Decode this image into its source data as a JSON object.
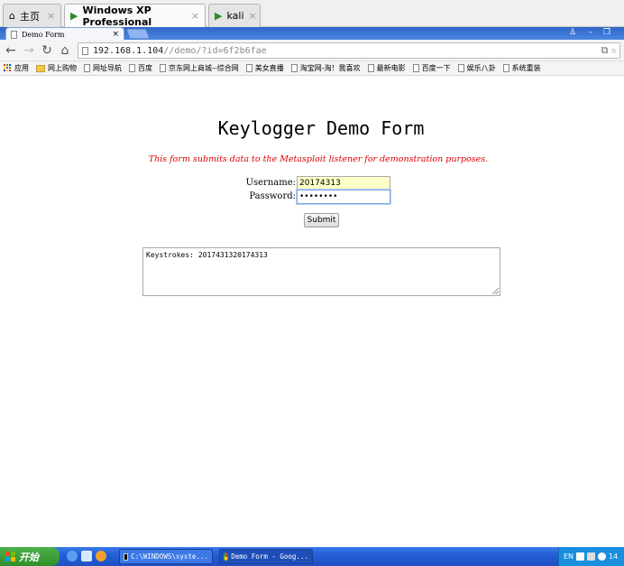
{
  "vm_tabs": [
    {
      "label": "主页",
      "icon": "home-icon"
    },
    {
      "label": "Windows XP Professional",
      "icon": "vm-play-icon",
      "active": true
    },
    {
      "label": "kali",
      "icon": "vm-play-icon"
    }
  ],
  "browser": {
    "tab_title": "Demo Form",
    "url_host": "192.168.1.104",
    "url_path": "//demo/?id=6f2b6fae"
  },
  "bookmarks": [
    {
      "label": "应用",
      "icon": "apps-icon"
    },
    {
      "label": "网上购物",
      "icon": "folder-icon"
    },
    {
      "label": "网址导航",
      "icon": "page-icon"
    },
    {
      "label": "百度",
      "icon": "page-icon"
    },
    {
      "label": "京东网上商城--综合网",
      "icon": "page-icon"
    },
    {
      "label": "美女直播",
      "icon": "page-icon"
    },
    {
      "label": "淘宝网-淘！我喜欢",
      "icon": "page-icon"
    },
    {
      "label": "最新电影",
      "icon": "page-icon"
    },
    {
      "label": "百度一下",
      "icon": "page-icon"
    },
    {
      "label": "娱乐八卦",
      "icon": "page-icon"
    },
    {
      "label": "系统重装",
      "icon": "page-icon"
    }
  ],
  "form": {
    "title": "Keylogger Demo Form",
    "subtitle": "This form submits data to the Metasploit listener for demonstration purposes.",
    "username_label": "Username:",
    "username_value": "20174313",
    "password_label": "Password:",
    "password_value": "••••••••",
    "submit_label": "Submit",
    "keystrokes_label": "Keystrokes:",
    "keystrokes_value": "2017431320174313"
  },
  "taskbar": {
    "start_label": "开始",
    "tasks": [
      {
        "label": "C:\\WINDOWS\\syste...",
        "icon": "cmd-icon"
      },
      {
        "label": "Demo Form - Goog...",
        "icon": "chrome-icon"
      }
    ],
    "tray_lang": "EN",
    "clock": "14"
  },
  "colors": {
    "subtitle": "#dd0000",
    "username_fill": "#ffffc8",
    "taskbar": "#245ed6",
    "start": "#3a9a36"
  }
}
